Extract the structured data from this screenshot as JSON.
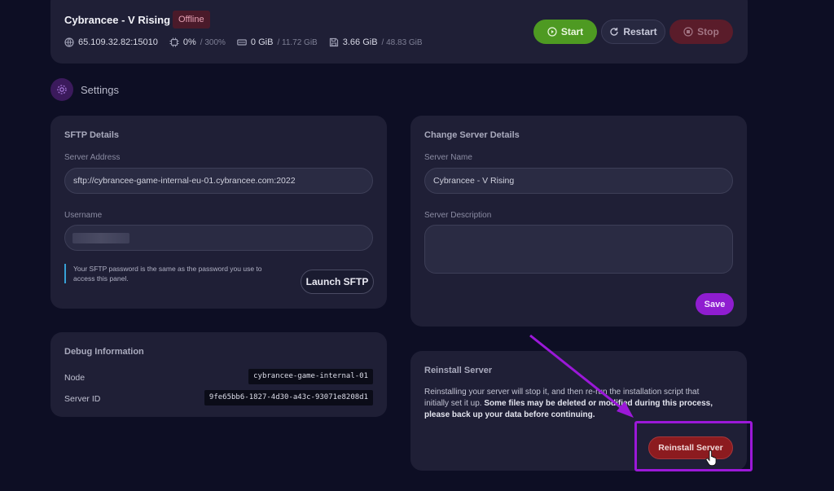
{
  "server": {
    "name": "Cybrancee - V Rising",
    "status": "Offline",
    "address": "65.109.32.82:15010",
    "cpu_value": "0%",
    "cpu_max": "/ 300%",
    "mem_value": "0 GiB",
    "mem_max": "/ 11.72 GiB",
    "disk_value": "3.66 GiB",
    "disk_max": "/ 48.83 GiB"
  },
  "power": {
    "start": "Start",
    "restart": "Restart",
    "stop": "Stop"
  },
  "section": {
    "title": "Settings"
  },
  "sftp": {
    "title": "SFTP Details",
    "address_label": "Server Address",
    "address_value": "sftp://cybrancee-game-internal-eu-01.cybrancee.com:2022",
    "username_label": "Username",
    "note": "Your SFTP password is the same as the password you use to access this panel.",
    "launch": "Launch SFTP"
  },
  "debug": {
    "title": "Debug Information",
    "node_label": "Node",
    "node_value": "cybrancee-game-internal-01",
    "id_label": "Server ID",
    "id_value": "9fe65bb6-1827-4d30-a43c-93071e8208d1"
  },
  "details": {
    "title": "Change Server Details",
    "name_label": "Server Name",
    "name_value": "Cybrancee - V Rising",
    "desc_label": "Server Description",
    "save": "Save"
  },
  "reinstall": {
    "title": "Reinstall Server",
    "text_plain": "Reinstalling your server will stop it, and then re-run the installation script that initially set it up.",
    "text_bold": "Some files may be deleted or modified during this process, please back up your data before continuing.",
    "button": "Reinstall Server"
  },
  "colors": {
    "background": "#0d0e24",
    "card": "#1f1f36",
    "accent_purple": "#8f1dd0",
    "start_green": "#4e9a22",
    "danger_red": "#8c1b1f"
  }
}
